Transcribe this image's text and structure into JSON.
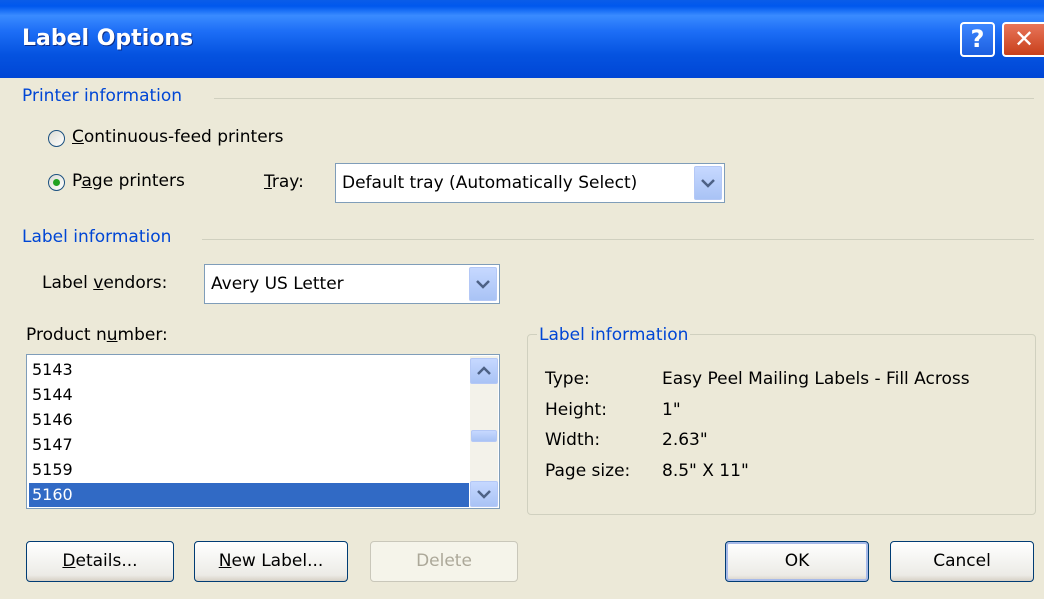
{
  "window": {
    "title": "Label Options",
    "help_glyph": "?",
    "close_glyph": "✕"
  },
  "printer_info": {
    "header": "Printer information",
    "continuous": {
      "underline": "C",
      "rest": "ontinuous-feed printers"
    },
    "page": {
      "pre": "P",
      "underline": "a",
      "rest": "ge printers"
    },
    "selected": "page",
    "tray_label": {
      "underline": "T",
      "rest": "ray:"
    },
    "tray_value": "Default tray (Automatically Select)"
  },
  "label_info": {
    "header": "Label information",
    "vendors_label": {
      "pre": "Label ",
      "underline": "v",
      "rest": "endors:"
    },
    "vendors_value": "Avery US Letter",
    "product_label": {
      "pre": "Product n",
      "underline": "u",
      "rest": "mber:"
    },
    "products": [
      "5143",
      "5144",
      "5146",
      "5147",
      "5159",
      "5160"
    ],
    "selected_product": "5160"
  },
  "details": {
    "header": "Label information",
    "rows": [
      {
        "key": "Type:",
        "value": "Easy Peel Mailing Labels - Fill Across"
      },
      {
        "key": "Height:",
        "value": "1\""
      },
      {
        "key": "Width:",
        "value": "2.63\""
      },
      {
        "key": "Page size:",
        "value": "8.5\" X 11\""
      }
    ]
  },
  "buttons": {
    "details": {
      "underline": "D",
      "rest": "etails..."
    },
    "new_label": {
      "underline": "N",
      "rest": "ew Label..."
    },
    "delete": "Delete",
    "ok": "OK",
    "cancel": "Cancel"
  },
  "colors": {
    "title_bar": "#0058ee",
    "group_header": "#0046d5",
    "selection": "#316ac5",
    "dialog_bg": "#ece9d8"
  }
}
